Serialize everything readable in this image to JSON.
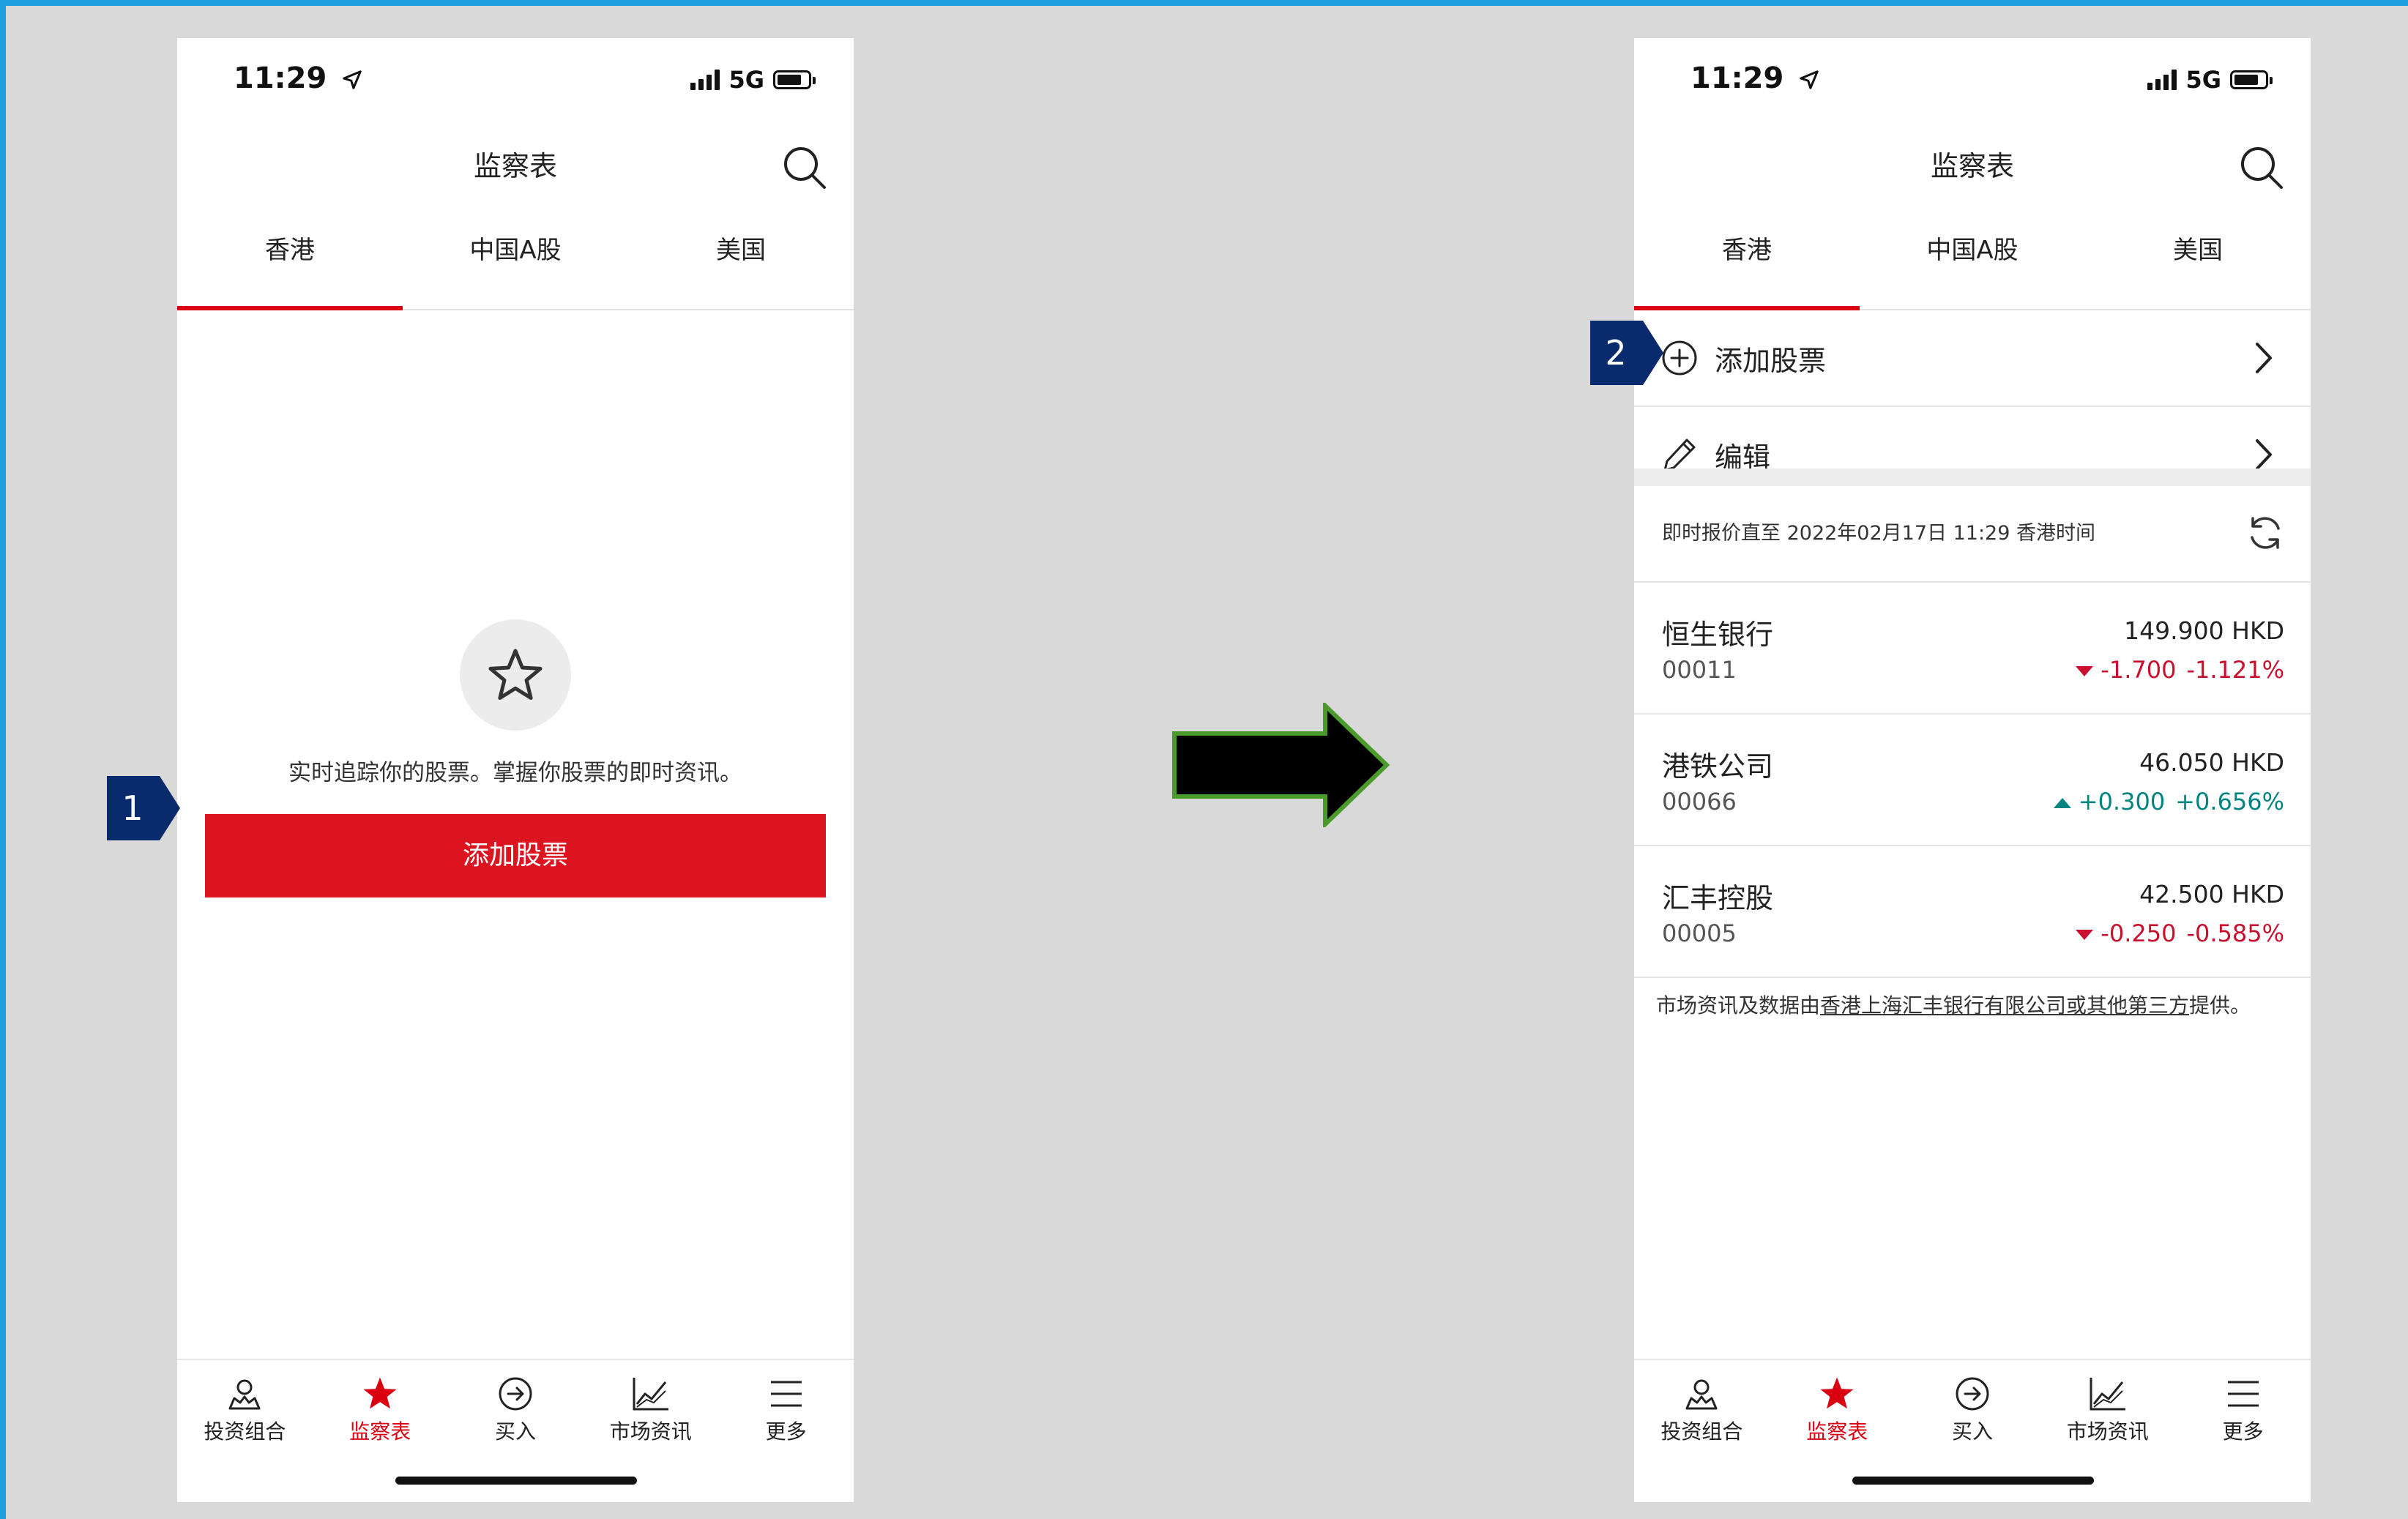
{
  "status_bar": {
    "time": "11:29",
    "network": "5G"
  },
  "left_screen": {
    "title": "监察表",
    "tabs": [
      "香港",
      "中国A股",
      "美国"
    ],
    "empty_message": "实时追踪你的股票。掌握你股票的即时资讯。",
    "add_button": "添加股票"
  },
  "right_screen": {
    "title": "监察表",
    "tabs": [
      "香港",
      "中国A股",
      "美国"
    ],
    "actions": {
      "add": "添加股票",
      "edit": "编辑"
    },
    "quote_time": "即时报价直至 2022年02月17日 11:29 香港时间",
    "stocks": [
      {
        "name": "恒生银行",
        "code": "00011",
        "price": "149.900 HKD",
        "change": "-1.700",
        "pct": "-1.121%",
        "dir": "down"
      },
      {
        "name": "港铁公司",
        "code": "00066",
        "price": "46.050 HKD",
        "change": "+0.300",
        "pct": "+0.656%",
        "dir": "up"
      },
      {
        "name": "汇丰控股",
        "code": "00005",
        "price": "42.500 HKD",
        "change": "-0.250",
        "pct": "-0.585%",
        "dir": "down"
      }
    ],
    "footnote_pre": "市场资讯及数据由",
    "footnote_link": "香港上海汇丰银行有限公司或其他第三方",
    "footnote_post": "提供。"
  },
  "tab_bar": [
    "投资组合",
    "监察表",
    "买入",
    "市场资讯",
    "更多"
  ],
  "markers": [
    "1",
    "2"
  ],
  "colors": {
    "brand_red": "#db0011",
    "marker_navy": "#0a2a6e",
    "up_green": "#00847f",
    "down_red": "#c8102e",
    "arrow_border": "#4a9a2c"
  }
}
